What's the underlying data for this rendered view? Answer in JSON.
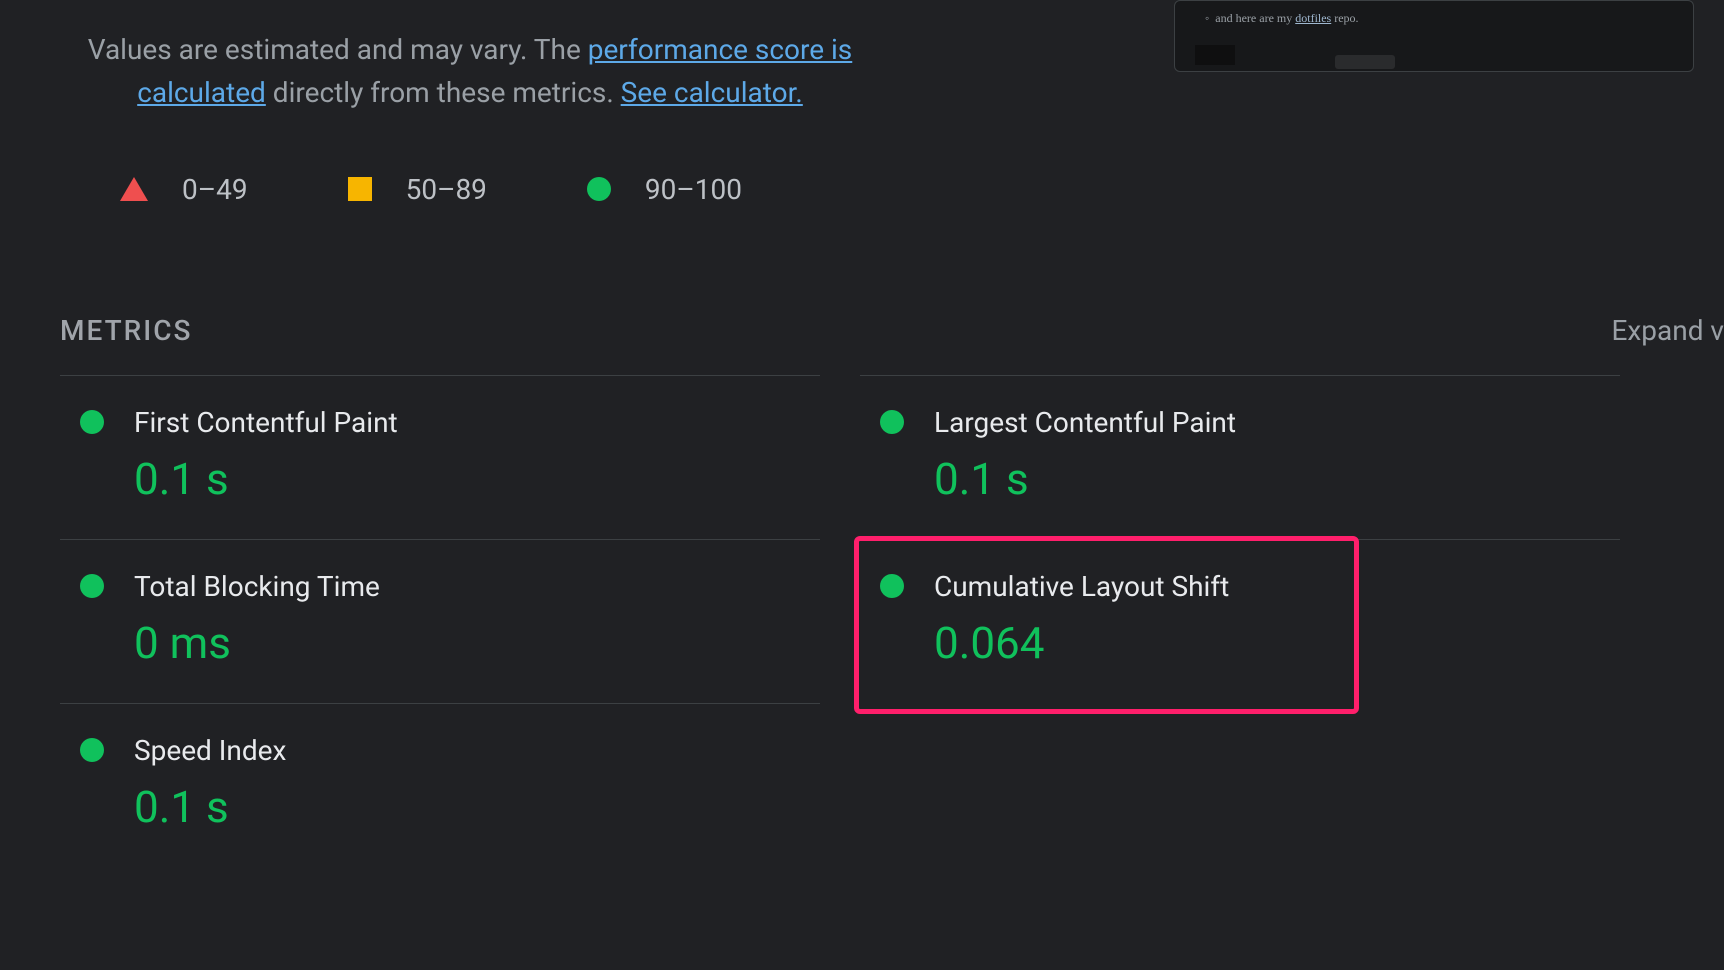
{
  "intro": {
    "prefix": "Values are estimated and may vary. The ",
    "link1": "performance score is calculated",
    "middle": " directly from these metrics. ",
    "link2": "See calculator."
  },
  "legend": {
    "poor": "0–49",
    "average": "50–89",
    "good": "90–100"
  },
  "section": {
    "title": "METRICS",
    "expand": "Expand v"
  },
  "metrics": {
    "fcp": {
      "label": "First Contentful Paint",
      "value": "0.1 s"
    },
    "lcp": {
      "label": "Largest Contentful Paint",
      "value": "0.1 s"
    },
    "tbt": {
      "label": "Total Blocking Time",
      "value": "0 ms"
    },
    "cls": {
      "label": "Cumulative Layout Shift",
      "value": "0.064"
    },
    "si": {
      "label": "Speed Index",
      "value": "0.1 s"
    }
  },
  "preview": {
    "bullet_prefix": "and here are my ",
    "bullet_link": "dotfiles",
    "bullet_suffix": " repo."
  }
}
